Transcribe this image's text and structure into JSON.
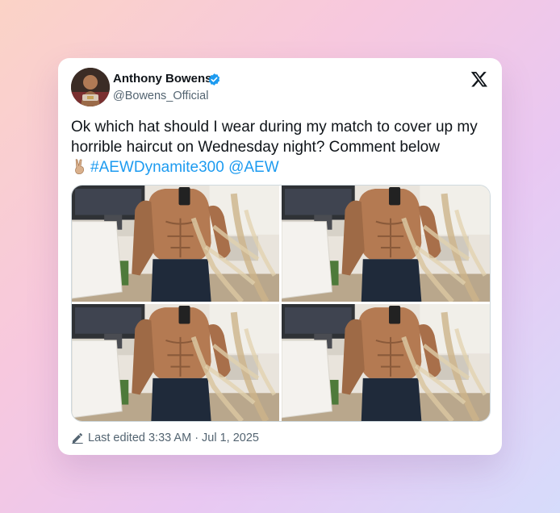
{
  "author": {
    "name": "Anthony Bowens",
    "handle": "@Bowens_Official",
    "verified": true
  },
  "platform_icon": "x-logo-icon",
  "post": {
    "text": "Ok which hat should I wear during my match to cover up my horrible haircut on Wednesday night? Comment below",
    "emoji": "victory-hand-emoji",
    "hashtag": "#AEWDynamite300",
    "mention": "@AEW"
  },
  "media": {
    "photos": [
      {
        "name": "mirror-selfie-photo-1"
      },
      {
        "name": "mirror-selfie-photo-2"
      },
      {
        "name": "mirror-selfie-photo-3"
      },
      {
        "name": "mirror-selfie-photo-4"
      }
    ]
  },
  "footer": {
    "icon": "pencil-icon",
    "edited_text": "Last edited 3:33 AM · Jul 1, 2025"
  },
  "colors": {
    "link": "#1d9bf0",
    "verified_badge": "#1d9bf0",
    "text": "#0f1419",
    "secondary_text": "#536471"
  }
}
